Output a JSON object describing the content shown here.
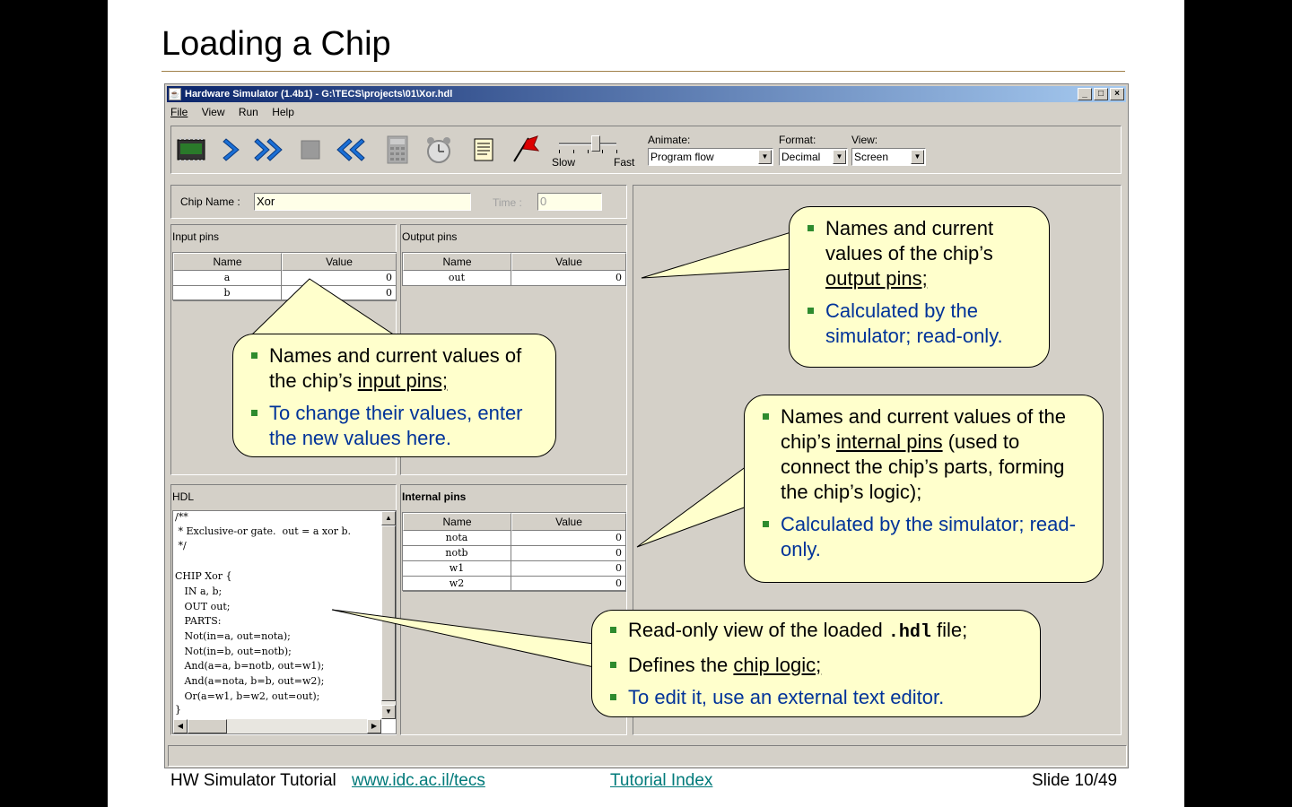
{
  "slide": {
    "title": "Loading a Chip",
    "footer": {
      "tutorial": "HW Simulator Tutorial",
      "url": "www.idc.ac.il/tecs",
      "index": "Tutorial Index",
      "slide_num": "Slide 10/49"
    }
  },
  "window": {
    "title": "Hardware Simulator (1.4b1) - G:\\TECS\\projects\\01\\Xor.hdl",
    "icon": "java-cup-icon",
    "controls": [
      "_",
      "□",
      "×"
    ]
  },
  "menu": [
    "File",
    "View",
    "Run",
    "Help"
  ],
  "toolbar": {
    "speed": {
      "slow": "Slow",
      "fast": "Fast"
    },
    "animate": {
      "label": "Animate:",
      "value": "Program flow"
    },
    "format": {
      "label": "Format:",
      "value": "Decimal"
    },
    "view": {
      "label": "View:",
      "value": "Screen"
    }
  },
  "chip": {
    "name_label": "Chip Name :",
    "name": "Xor",
    "time_label": "Time :",
    "time": "0"
  },
  "input_pins": {
    "title": "Input pins",
    "columns": [
      "Name",
      "Value"
    ],
    "rows": [
      {
        "name": "a",
        "value": "0"
      },
      {
        "name": "b",
        "value": "0"
      }
    ]
  },
  "output_pins": {
    "title": "Output pins",
    "columns": [
      "Name",
      "Value"
    ],
    "rows": [
      {
        "name": "out",
        "value": "0"
      }
    ]
  },
  "hdl": {
    "title": "HDL",
    "lines": [
      "/**",
      " * Exclusive-or gate.  out = a xor b.",
      " */",
      "",
      "CHIP Xor {",
      "   IN a, b;",
      "   OUT out;",
      "   PARTS:",
      "   Not(in=a, out=nota);",
      "   Not(in=b, out=notb);",
      "   And(a=a, b=notb, out=w1);",
      "   And(a=nota, b=b, out=w2);",
      "   Or(a=w1, b=w2, out=out);",
      "}"
    ]
  },
  "internal_pins": {
    "title": "Internal pins",
    "columns": [
      "Name",
      "Value"
    ],
    "rows": [
      {
        "name": "nota",
        "value": "0"
      },
      {
        "name": "notb",
        "value": "0"
      },
      {
        "name": "w1",
        "value": "0"
      },
      {
        "name": "w2",
        "value": "0"
      }
    ]
  },
  "callouts": {
    "output": {
      "b1": [
        "Names and current values of the chip’s ",
        "output pins;"
      ],
      "b2": "Calculated by the simulator; read-only."
    },
    "input": {
      "b1": [
        "Names and current values of the chip’s ",
        "input pins;"
      ],
      "b2": "To change their values, enter the new values here."
    },
    "internal": {
      "b1": [
        "Names and current values of the chip’s ",
        "internal pins",
        " (used to connect the chip’s parts, forming the chip’s logic);"
      ],
      "b2": "Calculated by the simulator; read-only."
    },
    "hdl": {
      "b1": [
        "Read-only view of the loaded ",
        ".hdl",
        " file;"
      ],
      "b2": [
        "Defines the ",
        "chip logic;"
      ],
      "b3": "To edit it, use an external text editor."
    }
  }
}
